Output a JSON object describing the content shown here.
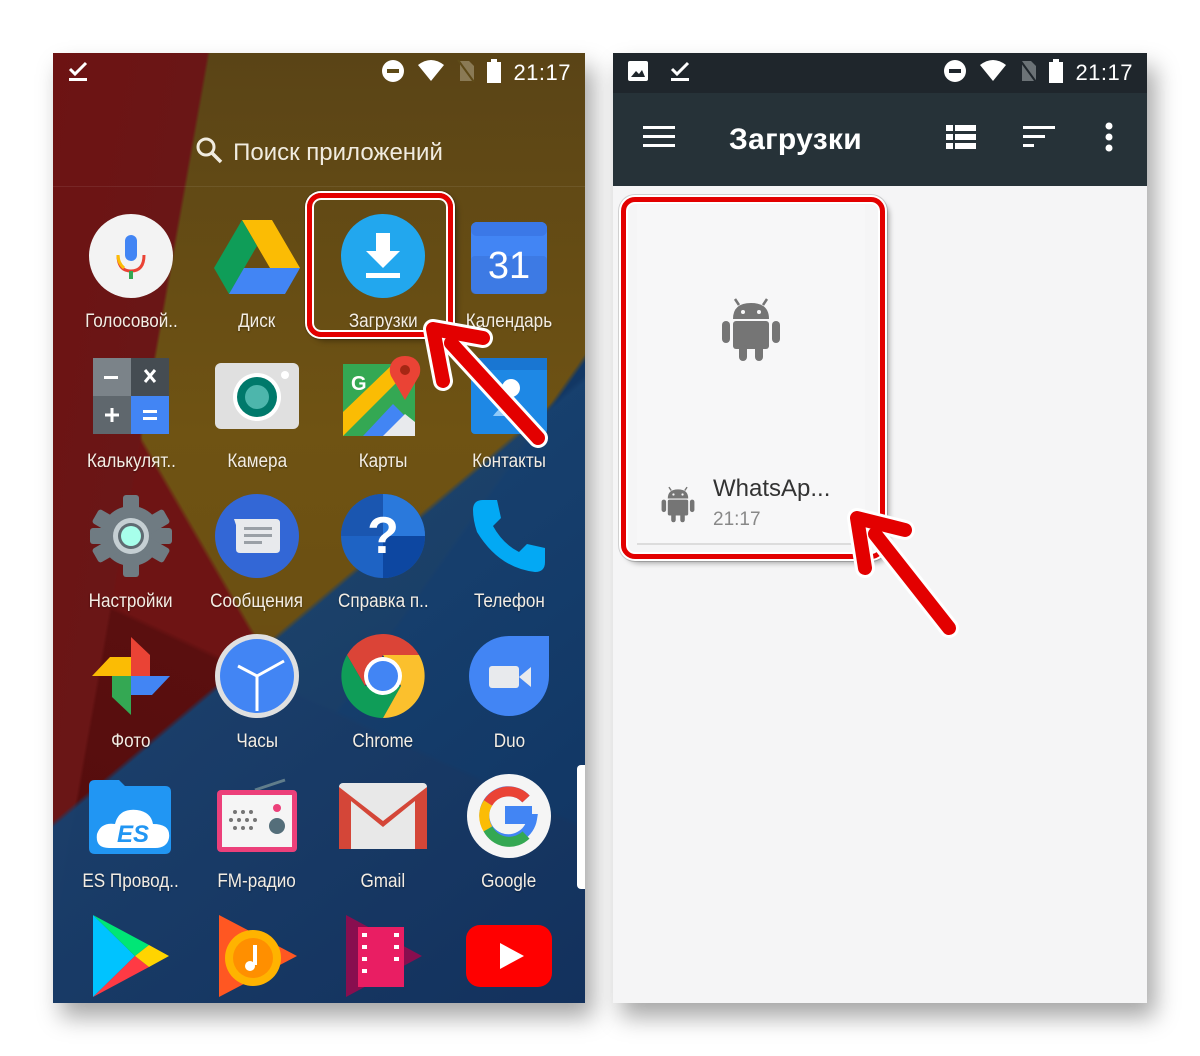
{
  "left_screen": {
    "status_bar": {
      "time": "21:17",
      "left_icons": [
        "download-complete-icon"
      ],
      "right_icons": [
        "do-not-disturb-icon",
        "wifi-icon",
        "no-sim-icon",
        "battery-icon"
      ]
    },
    "search": {
      "icon": "search-icon",
      "placeholder": "Поиск приложений"
    },
    "apps": [
      {
        "label": "Голосовой..",
        "icon": "voice-search-icon"
      },
      {
        "label": "Диск",
        "icon": "drive-icon"
      },
      {
        "label": "Загрузки",
        "icon": "downloads-icon",
        "highlighted": true
      },
      {
        "label": "Календарь",
        "icon": "calendar-icon",
        "badge": "31"
      },
      {
        "label": "Калькулят..",
        "icon": "calculator-icon"
      },
      {
        "label": "Камера",
        "icon": "camera-icon"
      },
      {
        "label": "Карты",
        "icon": "maps-icon"
      },
      {
        "label": "Контакты",
        "icon": "contacts-icon"
      },
      {
        "label": "Настройки",
        "icon": "settings-icon"
      },
      {
        "label": "Сообщения",
        "icon": "messages-icon"
      },
      {
        "label": "Справка п..",
        "icon": "help-icon"
      },
      {
        "label": "Телефон",
        "icon": "phone-icon"
      },
      {
        "label": "Фото",
        "icon": "photos-icon"
      },
      {
        "label": "Часы",
        "icon": "clock-icon"
      },
      {
        "label": "Chrome",
        "icon": "chrome-icon"
      },
      {
        "label": "Duo",
        "icon": "duo-icon"
      },
      {
        "label": "ES Провод..",
        "icon": "es-explorer-icon"
      },
      {
        "label": "FM-радио",
        "icon": "fm-radio-icon"
      },
      {
        "label": "Gmail",
        "icon": "gmail-icon"
      },
      {
        "label": "Google",
        "icon": "google-icon"
      },
      {
        "label": "",
        "icon": "play-store-icon"
      },
      {
        "label": "",
        "icon": "play-music-icon"
      },
      {
        "label": "",
        "icon": "play-movies-icon"
      },
      {
        "label": "",
        "icon": "youtube-icon"
      }
    ]
  },
  "right_screen": {
    "status_bar": {
      "time": "21:17",
      "left_icons": [
        "image-icon",
        "download-complete-icon"
      ],
      "right_icons": [
        "do-not-disturb-icon",
        "wifi-icon",
        "no-sim-icon",
        "battery-icon"
      ]
    },
    "toolbar": {
      "title": "Загрузки",
      "menu_icon": "hamburger-menu-icon",
      "actions": [
        "list-view-icon",
        "sort-icon",
        "more-vert-icon"
      ]
    },
    "downloads": [
      {
        "name": "WhatsAp...",
        "time": "21:17",
        "icon": "android-icon",
        "highlighted": true
      }
    ]
  },
  "annotations": {
    "highlight_color": "#e30000"
  }
}
